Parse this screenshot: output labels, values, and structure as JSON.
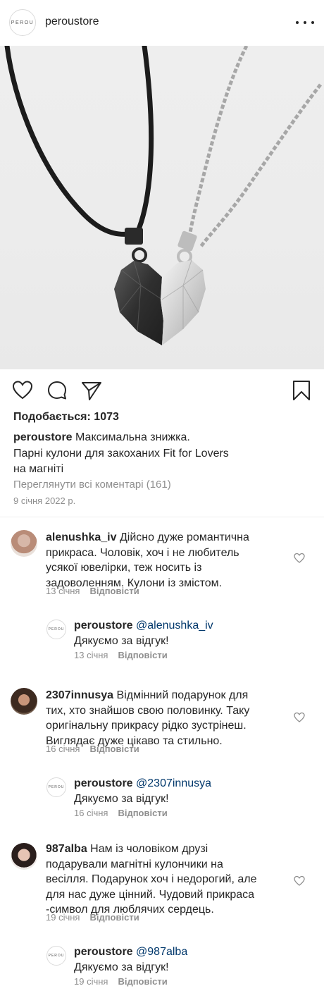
{
  "header": {
    "logo_text": "PEROU",
    "username": "peroustore"
  },
  "post": {
    "likes": "Подобається: 1073",
    "caption_user": "peroustore",
    "caption_line1": "Максимальна знижка.",
    "caption_line2": "Парні кулони для закоханих Fit for Lovers",
    "caption_line3": "на магніті",
    "view_all": "Переглянути всі коментарі (161)",
    "date": "9 січня 2022 р."
  },
  "comments": [
    {
      "user": "alenushka_iv",
      "lines": [
        "Дійсно дуже романтична",
        "прикраса. Чоловік, хоч і не любитель",
        "усякої ювелірки, теж носить із",
        "задоволенням. Кулони із змістом."
      ],
      "date": "13 січня",
      "reply_label": "Відповісти"
    },
    {
      "user": "2307innusya",
      "lines": [
        "Відмінний подарунок для",
        "тих, хто знайшов свою половинку. Таку",
        "оригінальну прикрасу рідко зустрінеш.",
        "Виглядає дуже цікаво та стильно."
      ],
      "date": "16 січня",
      "reply_label": "Відповісти"
    },
    {
      "user": "987alba",
      "lines": [
        "Нам із чоловіком друзі",
        "подарували магнітні кулончики на",
        "весілля. Подарунок хоч і недорогий, але",
        "для нас дуже цінний. Чудовий прикраса",
        "-символ для люблячих сердець."
      ],
      "date": "19 січня",
      "reply_label": "Відповісти"
    }
  ],
  "replies": [
    {
      "user": "peroustore",
      "mention": "@alenushka_iv",
      "text": "Дякуємо за відгук!",
      "date": "13 січня",
      "reply_label": "Відповісти",
      "logo_text": "PEROU"
    },
    {
      "user": "peroustore",
      "mention": "@2307innusya",
      "text": "Дякуємо за відгук!",
      "date": "16 січня",
      "reply_label": "Відповісти",
      "logo_text": "PEROU"
    },
    {
      "user": "peroustore",
      "mention": "@987alba",
      "text": "Дякуємо за відгук!",
      "date": "19 січня",
      "reply_label": "Відповісти",
      "logo_text": "PEROU"
    }
  ],
  "icons": {
    "like": "heart-icon",
    "comment": "comment-icon",
    "share": "paper-plane-icon",
    "save": "bookmark-icon",
    "more": "more-icon"
  }
}
